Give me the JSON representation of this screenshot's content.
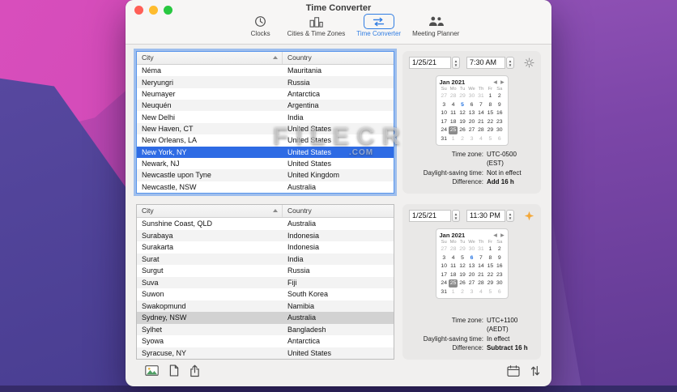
{
  "window": {
    "title": "Time Converter"
  },
  "traffic_lights": {
    "close": "#ff5f57",
    "minimize": "#febc2e",
    "zoom": "#28c840"
  },
  "toolbar": {
    "items": [
      {
        "label": "Clocks",
        "icon": "clock-icon",
        "selected": false
      },
      {
        "label": "Cities & Time Zones",
        "icon": "city-buildings-icon",
        "selected": false
      },
      {
        "label": "Time Converter",
        "icon": "convert-arrows-icon",
        "selected": true
      },
      {
        "label": "Meeting Planner",
        "icon": "people-icon",
        "selected": false
      }
    ]
  },
  "sections": [
    {
      "name": "source",
      "table": {
        "columns": [
          "City",
          "Country"
        ],
        "sorted_by": "City",
        "sort_ascending": true,
        "focused": true,
        "selected_city": "New York, NY",
        "rows": [
          {
            "city": "Néma",
            "country": "Mauritania"
          },
          {
            "city": "Neryungri",
            "country": "Russia"
          },
          {
            "city": "Neumayer",
            "country": "Antarctica"
          },
          {
            "city": "Neuquén",
            "country": "Argentina"
          },
          {
            "city": "New Delhi",
            "country": "India"
          },
          {
            "city": "New Haven, CT",
            "country": "United States"
          },
          {
            "city": "New Orleans, LA",
            "country": "United States"
          },
          {
            "city": "New York, NY",
            "country": "United States",
            "selected": true
          },
          {
            "city": "Newark, NJ",
            "country": "United States"
          },
          {
            "city": "Newcastle upon Tyne",
            "country": "United Kingdom"
          },
          {
            "city": "Newcastle, NSW",
            "country": "Australia"
          }
        ]
      },
      "panel": {
        "date": "1/25/21",
        "time": "7:30 AM",
        "day_night_icon": "sun-icon",
        "calendar": {
          "title": "Jan 2021",
          "day_headers": [
            "Su",
            "Mo",
            "Tu",
            "We",
            "Th",
            "Fr",
            "Sa"
          ],
          "weeks": [
            [
              27,
              28,
              29,
              30,
              31,
              1,
              2
            ],
            [
              3,
              4,
              5,
              6,
              7,
              8,
              9
            ],
            [
              10,
              11,
              12,
              13,
              14,
              15,
              16
            ],
            [
              17,
              18,
              19,
              20,
              21,
              22,
              23
            ],
            [
              24,
              25,
              26,
              27,
              28,
              29,
              30
            ],
            [
              31,
              1,
              2,
              3,
              4,
              5,
              6
            ]
          ],
          "selected_day": 25,
          "today_day": 5
        },
        "info": [
          {
            "label": "Time zone:",
            "value": "UTC-0500 (EST)",
            "bold": false
          },
          {
            "label": "Daylight-saving time:",
            "value": "Not in effect",
            "bold": false
          },
          {
            "label": "Difference:",
            "value": "Add 16 h",
            "bold": true
          }
        ]
      }
    },
    {
      "name": "target",
      "table": {
        "columns": [
          "City",
          "Country"
        ],
        "sorted_by": "City",
        "sort_ascending": true,
        "focused": false,
        "selected_city": "Sydney, NSW",
        "rows": [
          {
            "city": "Sunshine Coast, QLD",
            "country": "Australia"
          },
          {
            "city": "Surabaya",
            "country": "Indonesia"
          },
          {
            "city": "Surakarta",
            "country": "Indonesia"
          },
          {
            "city": "Surat",
            "country": "India"
          },
          {
            "city": "Surgut",
            "country": "Russia"
          },
          {
            "city": "Suva",
            "country": "Fiji"
          },
          {
            "city": "Suwon",
            "country": "South Korea"
          },
          {
            "city": "Swakopmund",
            "country": "Namibia"
          },
          {
            "city": "Sydney, NSW",
            "country": "Australia",
            "selected": true
          },
          {
            "city": "Sylhet",
            "country": "Bangladesh"
          },
          {
            "city": "Syowa",
            "country": "Antarctica"
          },
          {
            "city": "Syracuse, NY",
            "country": "United States"
          }
        ]
      },
      "panel": {
        "date": "1/25/21",
        "time": "11:30 PM",
        "day_night_icon": "night-star-icon",
        "calendar": {
          "title": "Jan 2021",
          "day_headers": [
            "Su",
            "Mo",
            "Tu",
            "We",
            "Th",
            "Fr",
            "Sa"
          ],
          "weeks": [
            [
              27,
              28,
              29,
              30,
              31,
              1,
              2
            ],
            [
              3,
              4,
              5,
              6,
              7,
              8,
              9
            ],
            [
              10,
              11,
              12,
              13,
              14,
              15,
              16
            ],
            [
              17,
              18,
              19,
              20,
              21,
              22,
              23
            ],
            [
              24,
              25,
              26,
              27,
              28,
              29,
              30
            ],
            [
              31,
              1,
              2,
              3,
              4,
              5,
              6
            ]
          ],
          "selected_day": 25,
          "today_day": 6
        },
        "info": [
          {
            "label": "Time zone:",
            "value": "UTC+1100 (AEDT)",
            "bold": false
          },
          {
            "label": "Daylight-saving time:",
            "value": "In effect",
            "bold": false
          },
          {
            "label": "Difference:",
            "value": "Subtract 16 h",
            "bold": true
          }
        ]
      }
    }
  ],
  "bottom_bar": {
    "left_buttons": [
      {
        "icon": "image-export-icon"
      },
      {
        "icon": "document-icon"
      },
      {
        "icon": "share-icon"
      }
    ],
    "right_buttons": [
      {
        "icon": "calendar-icon"
      },
      {
        "icon": "swap-arrows-icon"
      }
    ]
  },
  "watermark": {
    "title": "FILECR",
    "suffix": ".COM"
  },
  "colors": {
    "accent_blue": "#2f7ce2",
    "selected_row_focused": "#2e6be4",
    "selected_row_unfocused": "#d2d2d2",
    "today_blue": "#1f6fe0",
    "night_star_yellow": "#f3a83a"
  }
}
